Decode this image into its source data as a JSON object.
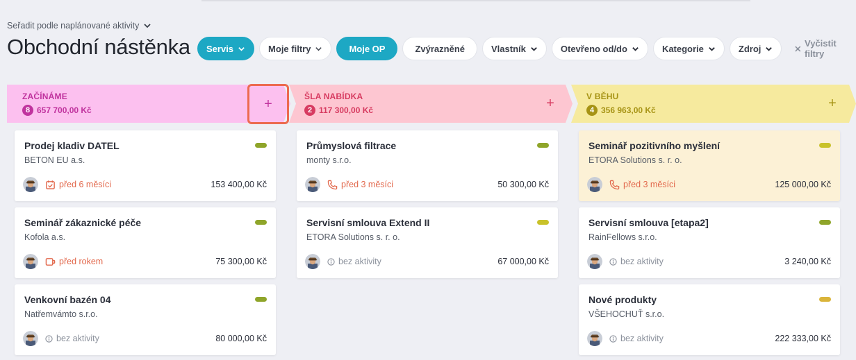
{
  "sort": {
    "label": "Seřadit podle naplánované aktivity"
  },
  "page": {
    "title": "Obchodní nástěnka"
  },
  "filters": {
    "servis": "Servis",
    "moje_filtry": "Moje filtry",
    "moje_op": "Moje OP",
    "zvyraznene": "Zvýrazněné",
    "vlastnik": "Vlastník",
    "otevreno": "Otevřeno od/do",
    "kategorie": "Kategorie",
    "zdroj": "Zdroj",
    "clear": "Vyčistit filtry"
  },
  "columns": [
    {
      "name": "ZAČÍNÁME",
      "count": "8",
      "sum": "657 700,00 Kč",
      "add": "+",
      "bg": "#fcc0ef",
      "accent": "#c0339e",
      "badge": "#c0339e",
      "cards": [
        {
          "title": "Prodej kladiv DATEL",
          "company": "BETON EU a.s.",
          "activity": "před 6 měsíci",
          "activity_icon": "task-icon",
          "amount": "153 400,00 Kč",
          "tag": "#8fa52a"
        },
        {
          "title": "Seminář zákaznické péče",
          "company": "Kofola a.s.",
          "activity": "před rokem",
          "activity_icon": "meeting-icon",
          "amount": "75 300,00 Kč",
          "tag": "#8fa52a"
        },
        {
          "title": "Venkovní bazén 04",
          "company": "Natřemvámto s.r.o.",
          "activity": "bez aktivity",
          "activity_icon": "info-icon",
          "amount": "80 000,00 Kč",
          "tag": "#8fa52a"
        }
      ]
    },
    {
      "name": "ŠLA NABÍDKA",
      "count": "2",
      "sum": "117 300,00 Kč",
      "add": "+",
      "bg": "#fdc6d1",
      "accent": "#d73b60",
      "badge": "#d73b60",
      "cards": [
        {
          "title": "Průmyslová filtrace",
          "company": "monty s.r.o.",
          "activity": "před 3 měsíci",
          "activity_icon": "phone-icon",
          "amount": "50 300,00 Kč",
          "tag": "#8fa52a"
        },
        {
          "title": "Servisní smlouva Extend II",
          "company": "ETORA Solutions s. r. o.",
          "activity": "bez aktivity",
          "activity_icon": "info-icon",
          "amount": "67 000,00 Kč",
          "tag": "#c9c22a"
        }
      ]
    },
    {
      "name": "V BĚHU",
      "count": "4",
      "sum": "356 963,00 Kč",
      "add": "+",
      "bg": "#f6ea9e",
      "accent": "#a69314",
      "badge": "#a69314",
      "cards": [
        {
          "title": "Seminář pozitivního myšlení",
          "company": "ETORA Solutions s. r. o.",
          "activity": "před 3 měsíci",
          "activity_icon": "phone-icon",
          "amount": "125 000,00 Kč",
          "tag": "#c9c22a"
        },
        {
          "title": "Servisní smlouva [etapa2]",
          "company": "RainFellows s.r.o.",
          "activity": "bez aktivity",
          "activity_icon": "info-icon",
          "amount": "3 240,00 Kč",
          "tag": "#8fa52a"
        },
        {
          "title": "Nové produkty",
          "company": "VŠEHOCHUŤ s.r.o.",
          "activity": "bez aktivity",
          "activity_icon": "info-icon",
          "amount": "222 333,00 Kč",
          "tag": "#dab43a"
        }
      ]
    }
  ]
}
